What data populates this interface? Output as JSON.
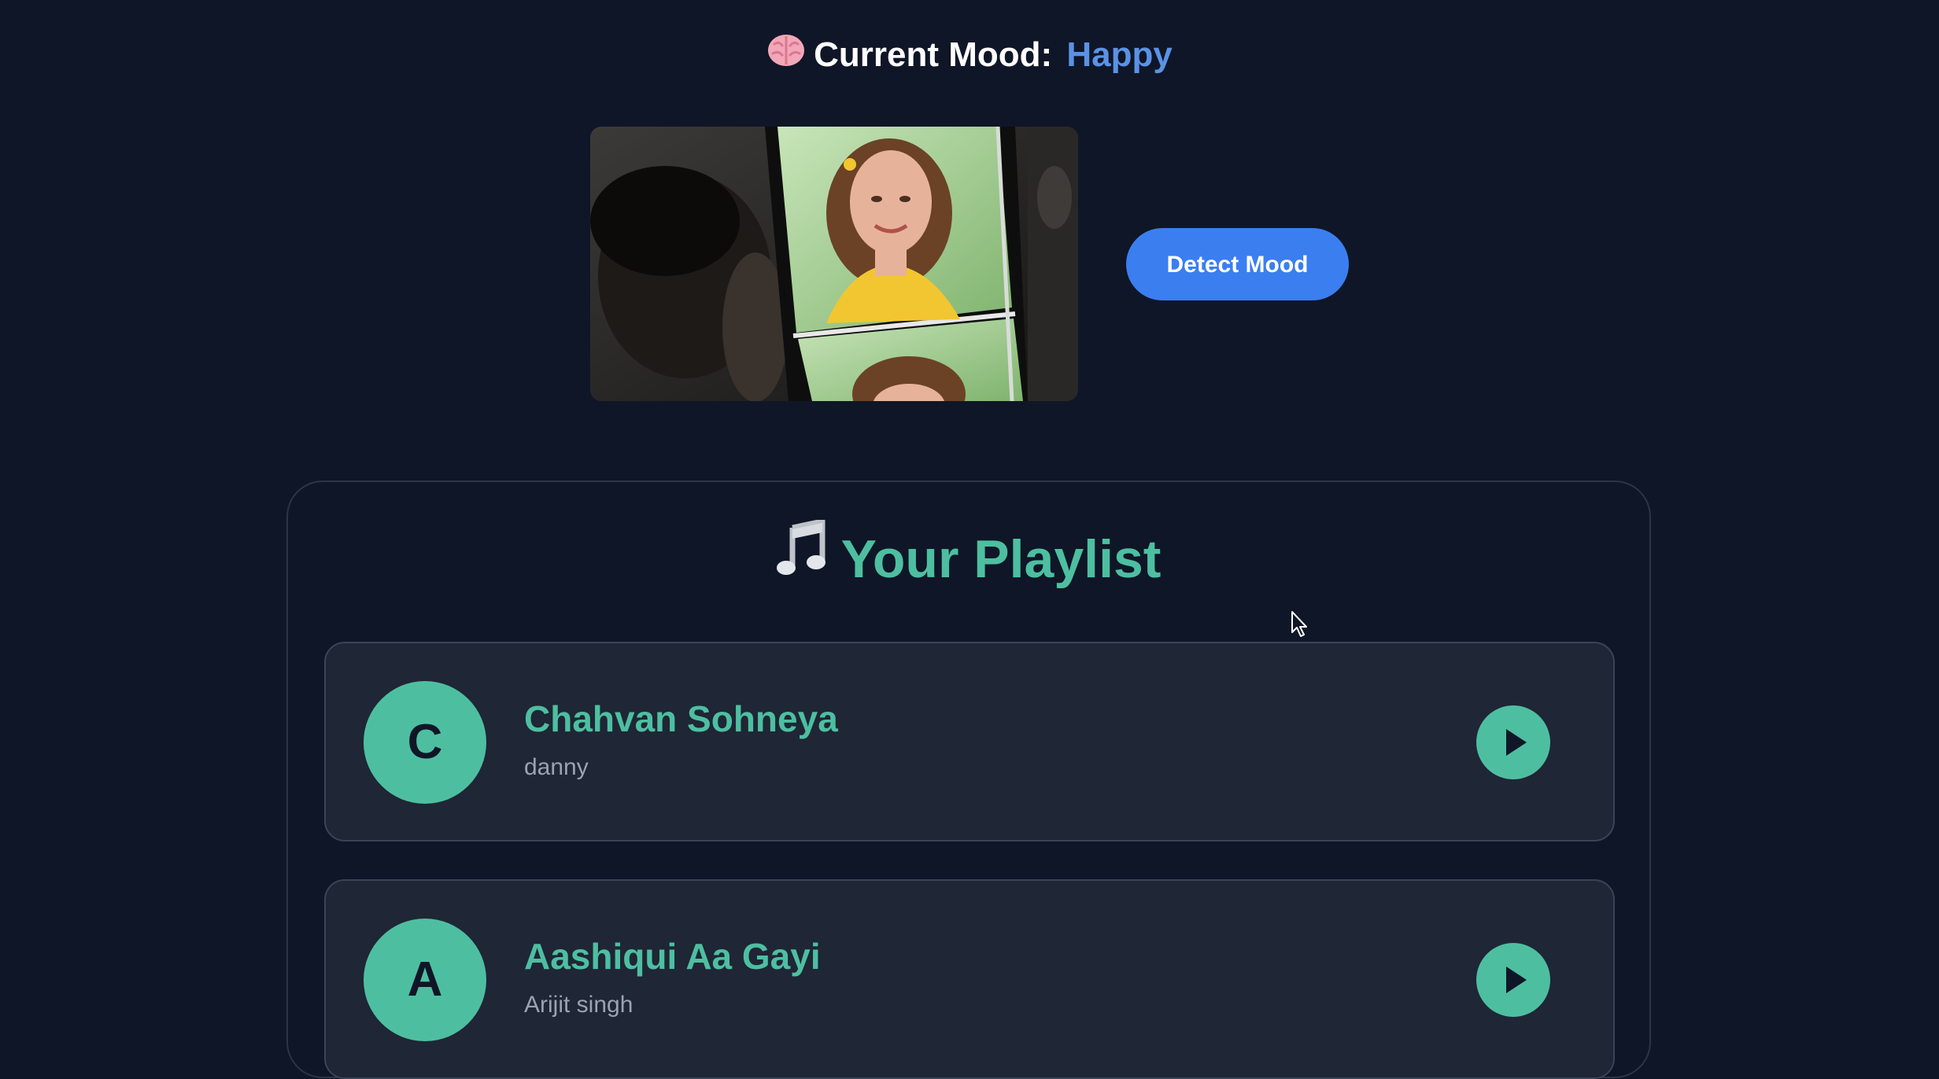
{
  "header": {
    "icon": "brain-icon",
    "label": "Current Mood:",
    "mood": "Happy",
    "mood_color": "#5b92e5"
  },
  "webcam": {
    "icon": "webcam-feed"
  },
  "detect_button": {
    "label": "Detect Mood",
    "color": "#3b7ef0"
  },
  "playlist": {
    "icon": "music-note-icon",
    "title": "Your Playlist",
    "accent_color": "#4dbfa0",
    "songs": [
      {
        "initial": "C",
        "title": "Chahvan Sohneya",
        "artist": "danny",
        "action_icon": "play-icon"
      },
      {
        "initial": "A",
        "title": "Aashiqui Aa Gayi",
        "artist": "Arijit singh",
        "action_icon": "play-icon"
      }
    ]
  }
}
